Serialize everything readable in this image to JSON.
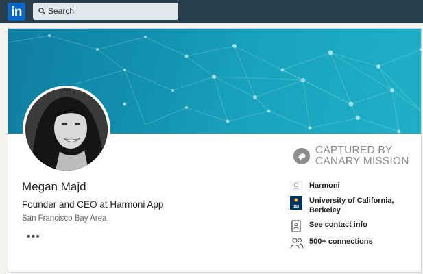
{
  "nav": {
    "logo_text": "in",
    "search_placeholder": "Search"
  },
  "profile": {
    "name": "Megan Majd",
    "headline": "Founder and CEO at Harmoni App",
    "location": "San Francisco Bay Area",
    "more_label": "•••"
  },
  "watermark": {
    "line1": "CAPTURED BY",
    "line2": "CANARY MISSION"
  },
  "sidebar": {
    "items": [
      {
        "label": "Harmoni",
        "icon": "company-logo-icon"
      },
      {
        "label_line1": "University of California,",
        "label_line2": "Berkeley",
        "icon": "school-logo-icon"
      },
      {
        "label": "See contact info",
        "icon": "contact-card-icon"
      },
      {
        "label": "500+ connections",
        "icon": "people-icon"
      }
    ]
  },
  "colors": {
    "topbar": "#283e4a",
    "brand": "#0a66c2",
    "banner": "#1a9fba"
  }
}
